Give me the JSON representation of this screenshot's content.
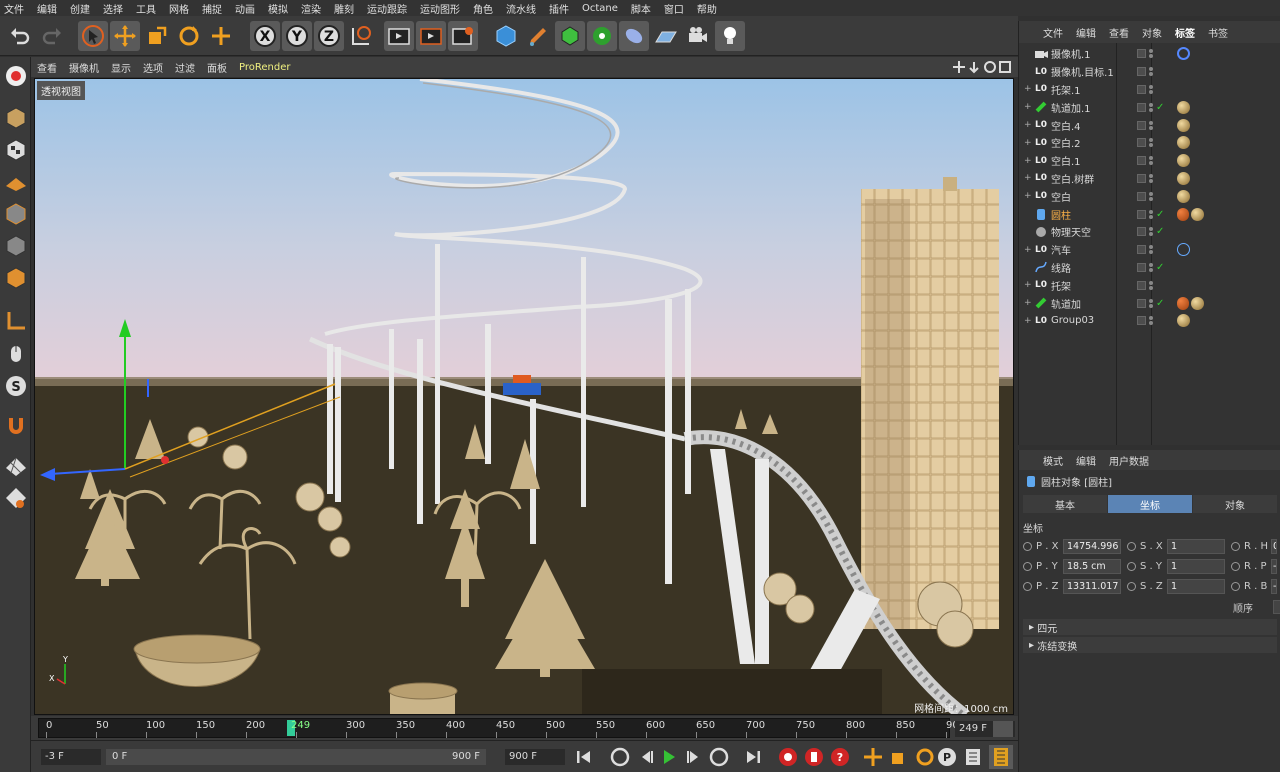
{
  "menubar": {
    "items": [
      "文件",
      "编辑",
      "创建",
      "选择",
      "工具",
      "网格",
      "捕捉",
      "动画",
      "模拟",
      "渲染",
      "雕刻",
      "运动跟踪",
      "运动图形",
      "角色",
      "流水线",
      "插件",
      "Octane",
      "脚本",
      "窗口",
      "帮助"
    ]
  },
  "viewport": {
    "menu": [
      "查看",
      "摄像机",
      "显示",
      "选项",
      "过滤",
      "面板"
    ],
    "renderer": "ProRender",
    "label": "透视视图",
    "grid_info": "网格间距：1000 cm"
  },
  "timeline": {
    "ticks": [
      "0",
      "50",
      "100",
      "150",
      "200",
      "249",
      "300",
      "350",
      "400",
      "450",
      "500",
      "550",
      "600",
      "650",
      "700",
      "750",
      "800",
      "850",
      "90"
    ],
    "current_frame": "249",
    "end_field": "249 F"
  },
  "transport": {
    "start": "-3 F",
    "range_start": "0 F",
    "range_end": "900 F",
    "end": "900 F"
  },
  "objects": {
    "menu": [
      "文件",
      "编辑",
      "查看",
      "对象",
      "标签",
      "书签"
    ],
    "active_menu": "标签",
    "rows": [
      {
        "name": "摄像机.1",
        "icon": "camera",
        "exp": ""
      },
      {
        "name": "摄像机.目标.1",
        "icon": "null",
        "exp": ""
      },
      {
        "name": "托架.1",
        "icon": "null",
        "exp": "+"
      },
      {
        "name": "轨道加.1",
        "icon": "plugin",
        "exp": "+"
      },
      {
        "name": "空白.4",
        "icon": "null",
        "exp": "+"
      },
      {
        "name": "空白.2",
        "icon": "null",
        "exp": "+"
      },
      {
        "name": "空白.1",
        "icon": "null",
        "exp": "+"
      },
      {
        "name": "空白.树群",
        "icon": "null",
        "exp": "+"
      },
      {
        "name": "空白",
        "icon": "null",
        "exp": "+"
      },
      {
        "name": "圆柱",
        "icon": "cylinder",
        "exp": ""
      },
      {
        "name": "物理天空",
        "icon": "sky",
        "exp": ""
      },
      {
        "name": "汽车",
        "icon": "null",
        "exp": "+"
      },
      {
        "name": "线路",
        "icon": "spline",
        "exp": ""
      },
      {
        "name": "托架",
        "icon": "null",
        "exp": "+"
      },
      {
        "name": "轨道加",
        "icon": "plugin",
        "exp": "+"
      },
      {
        "name": "Group03",
        "icon": "null",
        "exp": "+"
      }
    ],
    "selected": "圆柱"
  },
  "attributes": {
    "menu": [
      "模式",
      "编辑",
      "用户数据"
    ],
    "title": "圆柱对象 [圆柱]",
    "tabs": [
      "基本",
      "坐标",
      "对象"
    ],
    "active_tab": "坐标",
    "section": "坐标",
    "rows": [
      {
        "pl": "P . X",
        "pv": "14754.996",
        "sl": "S . X",
        "sv": "1",
        "rl": "R . H",
        "rv": "0"
      },
      {
        "pl": "P . Y",
        "pv": "18.5 cm",
        "sl": "S . Y",
        "sv": "1",
        "rl": "R . P",
        "rv": "-"
      },
      {
        "pl": "P . Z",
        "pv": "13311.017",
        "sl": "S . Z",
        "sv": "1",
        "rl": "R . B",
        "rv": "-"
      }
    ],
    "order_label": "顺序",
    "sections": [
      "四元",
      "冻结变换"
    ]
  }
}
